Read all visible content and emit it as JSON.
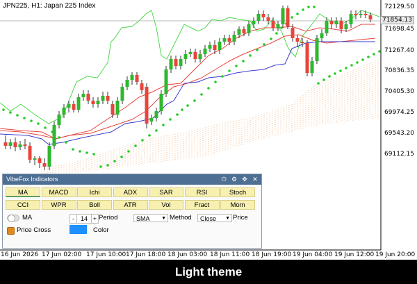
{
  "chart": {
    "title": "JPN225, H1:  Japan 225 Index",
    "current_price": "71854.13",
    "price_labels": [
      "72129.50",
      "71698.45",
      "71267.40",
      "70836.35",
      "70405.30",
      "69974.25",
      "69543.20",
      "69112.15"
    ],
    "time_labels": [
      "16 Jun 2026",
      "17 Jun 02:00",
      "17 Jun 10:00",
      "17 Jun 18:00",
      "18 Jun 03:00",
      "18 Jun 11:00",
      "18 Jun 19:00",
      "19 Jun 04:00",
      "19 Jun 12:00",
      "19 Jun 20:00"
    ],
    "colors": {
      "bull": "#2db82d",
      "bear": "#e8453c",
      "ma_red": "#e8453c",
      "ma_blue": "#3a3acf",
      "ichimoku_green": "#4cd94c",
      "sar_dots": "#22cc22",
      "cloud": "#f5b88a"
    }
  },
  "panel": {
    "title": "VibeFox Indicators",
    "header_icons": [
      "power-icon",
      "gear-icon",
      "move-icon",
      "close-icon"
    ],
    "header_glyphs": [
      "⏻",
      "⚙",
      "✥",
      "✕"
    ],
    "indicator_buttons": [
      [
        "MA",
        "MACD",
        "Ichi",
        "ADX",
        "SAR",
        "RSI",
        "Stoch"
      ],
      [
        "CCI",
        "WPR",
        "Boll",
        "ATR",
        "Vol",
        "Fract",
        "Mom"
      ]
    ],
    "active_indicator": "MA",
    "ma_toggle_label": "MA",
    "period_minus": "-",
    "period_value": "14",
    "period_plus": "+",
    "period_label": "Period",
    "method_value": "SMA",
    "method_label": "Method",
    "price_value": "Close",
    "price_label": "Price",
    "price_cross_label": "Price Cross",
    "color_label": "Color"
  },
  "footer": {
    "caption": "Light theme"
  }
}
